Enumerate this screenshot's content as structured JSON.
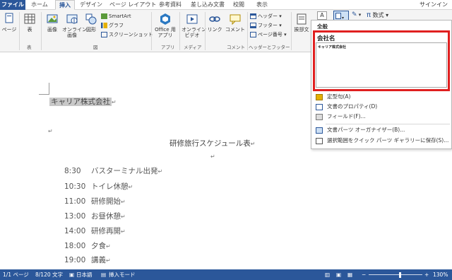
{
  "tabs": [
    {
      "label": "ファイル"
    },
    {
      "label": "ホーム"
    },
    {
      "label": "挿入"
    },
    {
      "label": "デザイン"
    },
    {
      "label": "ページ レイアウト"
    },
    {
      "label": "参考資料"
    },
    {
      "label": "差し込み文書"
    },
    {
      "label": "校閲"
    },
    {
      "label": "表示"
    }
  ],
  "signin": "サインイン",
  "ribbon": {
    "page": "ページ",
    "table": "表",
    "table_group": "表",
    "picture": "画像",
    "online_picture": "オンライン\n画像",
    "shapes": "図形",
    "smartart": "SmartArt",
    "chart": "グラフ",
    "screenshot": "スクリーンショット",
    "figure_group": "図",
    "office_apps": "Office 用\nアプリ",
    "apps_group": "アプリ",
    "online_video": "オンライン\nビデオ",
    "media_group": "メディア",
    "link": "リンク",
    "comment": "コメント",
    "comment_group": "コメント",
    "header": "ヘッダー",
    "footer": "フッター",
    "page_number": "ページ番号",
    "hf_group": "ヘッダーとフッター",
    "greeting": "挨拶文",
    "equation": "数式"
  },
  "dropdown": {
    "section": "全般",
    "block_title": "会社名",
    "block_preview": "キャリア株式会社",
    "items": [
      {
        "label": "定型句(A)"
      },
      {
        "label": "文書のプロパティ(D)"
      },
      {
        "label": "フィールド(F)..."
      },
      {
        "label": "文書パーツ オーガナイザー(B)..."
      },
      {
        "label": "選択範囲をクイック パーツ ギャラリーに保存(S)..."
      }
    ]
  },
  "document": {
    "selected_text": "キャリア株式会社",
    "title": "研修旅行スケジュール表",
    "para_mark": "↵",
    "schedule": [
      {
        "time": "8:30",
        "event": "バスターミナル出発"
      },
      {
        "time": "10:30",
        "event": "トイレ休憩"
      },
      {
        "time": "11:00",
        "event": "研修開始"
      },
      {
        "time": "13:00",
        "event": "お昼休憩"
      },
      {
        "time": "14:00",
        "event": "研修再開"
      },
      {
        "time": "18:00",
        "event": "夕食"
      },
      {
        "time": "19:00",
        "event": "講義"
      }
    ]
  },
  "status": {
    "page": "1/1 ページ",
    "words": "8/120 文字",
    "language": "日本語",
    "mode": "挿入モード",
    "zoom": "130%"
  },
  "colors": {
    "brand": "#2b579a",
    "highlight_box": "#e02020"
  }
}
